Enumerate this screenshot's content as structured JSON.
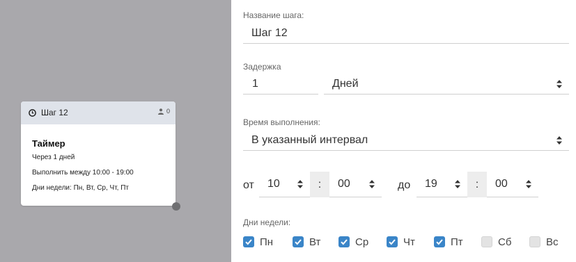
{
  "node": {
    "title": "Шаг 12",
    "user_count": "0",
    "heading": "Таймер",
    "lines": [
      "Через 1 дней",
      "Выполнить между 10:00 - 19:00",
      "Дни недели: Пн, Вт, Ср, Чт, Пт"
    ]
  },
  "panel": {
    "step_name_label": "Название шага:",
    "step_name_value": "Шаг 12",
    "delay_label": "Задержка",
    "delay_value": "1",
    "delay_unit": "Дней",
    "exec_time_label": "Время выполнения:",
    "exec_time_value": "В указанный интервал",
    "from_label": "от",
    "from_hour": "10",
    "from_min": "00",
    "to_label": "до",
    "to_hour": "19",
    "to_min": "00",
    "colon": ":",
    "weekdays_label": "Дни недели:",
    "days": [
      {
        "label": "Пн",
        "checked": true
      },
      {
        "label": "Вт",
        "checked": true
      },
      {
        "label": "Ср",
        "checked": true
      },
      {
        "label": "Чт",
        "checked": true
      },
      {
        "label": "Пт",
        "checked": true
      },
      {
        "label": "Сб",
        "checked": false
      },
      {
        "label": "Вс",
        "checked": false
      }
    ]
  },
  "colors": {
    "canvas": "#a9a8ac",
    "node_header": "#dfe3ea",
    "checkbox_on": "#3a85c8",
    "checkbox_off": "#e3e3e3"
  },
  "icons": [
    "clock-icon",
    "user-icon",
    "select-arrows-icon",
    "check-icon"
  ]
}
